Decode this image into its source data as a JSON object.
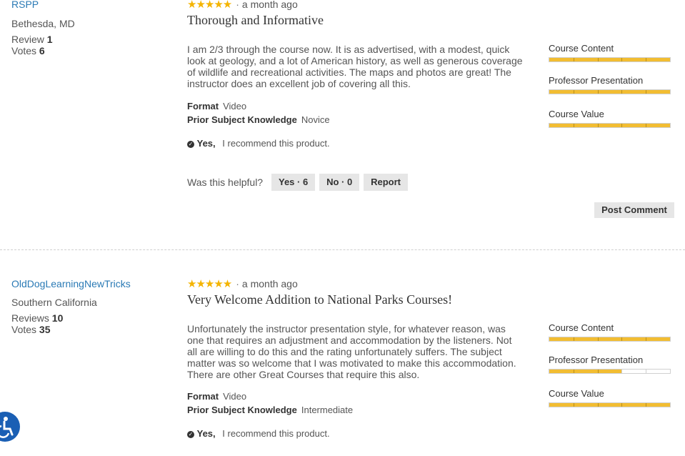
{
  "reviews": [
    {
      "username": "RSPP",
      "location": "Bethesda, MD",
      "stat1_label": "Review",
      "stat1_value": "1",
      "stat2_label": "Votes",
      "stat2_value": "6",
      "stars": "★★★★★",
      "time": "a month ago",
      "title": "Thorough and Informative",
      "body": "I am 2/3 through the course now. It is as advertised, with a modest, quick look at geology, and a lot of American history, as well as generous coverage of wildlife and recreational activities. The maps and photos are great! The instructor does an excellent job of covering all this.",
      "format_label": "Format",
      "format_value": "Video",
      "knowledge_label": "Prior Subject Knowledge",
      "knowledge_value": "Novice",
      "recommend_yes": "Yes,",
      "recommend_text": "I recommend this product.",
      "helpful_question": "Was this helpful?",
      "yes_button": "Yes · 6",
      "no_button": "No · 0",
      "report_button": "Report",
      "post_comment_button": "Post Comment",
      "ratings": [
        {
          "label": "Course Content",
          "value": 5,
          "max": 5
        },
        {
          "label": "Professor Presentation",
          "value": 5,
          "max": 5
        },
        {
          "label": "Course Value",
          "value": 5,
          "max": 5
        }
      ]
    },
    {
      "username": "OldDogLearningNewTricks",
      "location": "Southern California",
      "stat1_label": "Reviews",
      "stat1_value": "10",
      "stat2_label": "Votes",
      "stat2_value": "35",
      "stars": "★★★★★",
      "time": "a month ago",
      "title": "Very Welcome Addition to National Parks Courses!",
      "body": "Unfortunately the instructor presentation style, for whatever reason, was one that requires an adjustment and accommodation by the listeners. Not all are willing to do this and the rating unfortunately suffers. The subject matter was so welcome that I was motivated to make this accommodation. There are other Great Courses that require this also.",
      "format_label": "Format",
      "format_value": "Video",
      "knowledge_label": "Prior Subject Knowledge",
      "knowledge_value": "Intermediate",
      "recommend_yes": "Yes,",
      "recommend_text": "I recommend this product.",
      "ratings": [
        {
          "label": "Course Content",
          "value": 5,
          "max": 5
        },
        {
          "label": "Professor Presentation",
          "value": 3,
          "max": 5
        },
        {
          "label": "Course Value",
          "value": 5,
          "max": 5
        }
      ]
    }
  ],
  "colors": {
    "star": "#f4b400",
    "bar_fill": "#f2bd32",
    "link": "#2a7ab5",
    "accessibility_button": "#1a5fb4"
  },
  "icons": {
    "check": "check-circle-icon",
    "accessibility": "accessibility-icon"
  }
}
